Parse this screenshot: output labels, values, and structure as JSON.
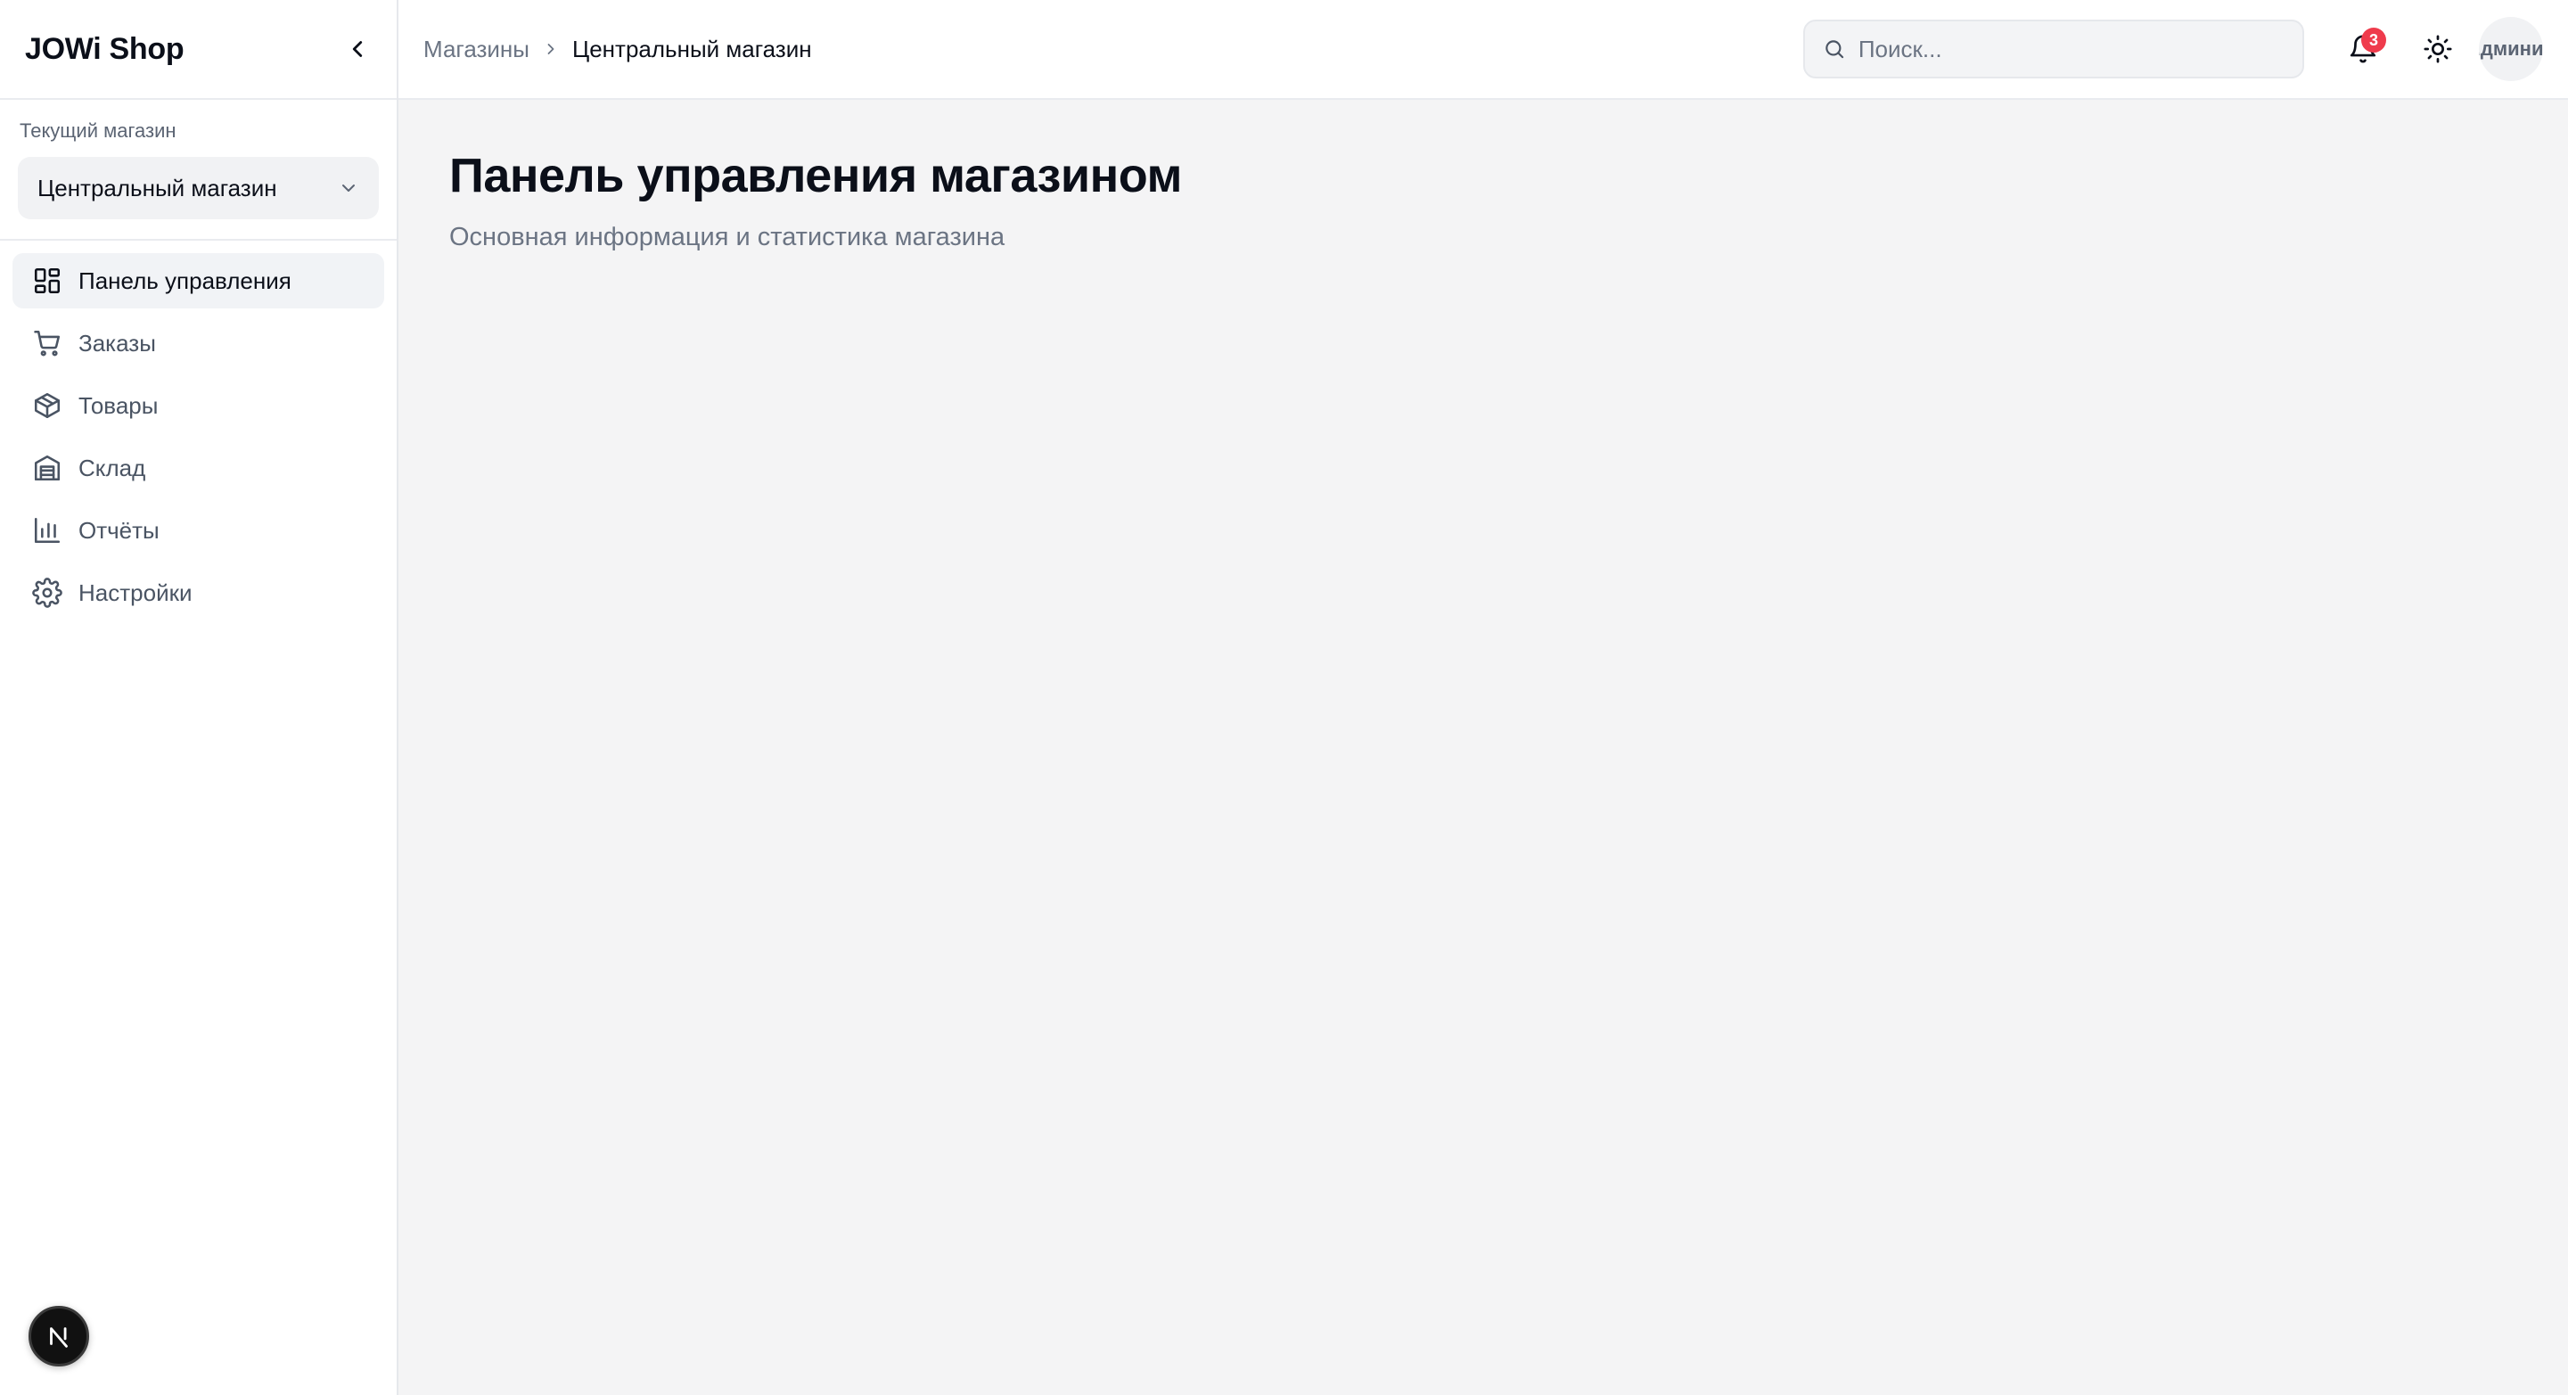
{
  "sidebar": {
    "brand": "JOWi Shop",
    "store_label": "Текущий магазин",
    "store_selected": "Центральный магазин",
    "items": [
      {
        "label": "Панель управления",
        "icon": "dashboard-icon",
        "active": true
      },
      {
        "label": "Заказы",
        "icon": "cart-icon",
        "active": false
      },
      {
        "label": "Товары",
        "icon": "package-icon",
        "active": false
      },
      {
        "label": "Склад",
        "icon": "warehouse-icon",
        "active": false
      },
      {
        "label": "Отчёты",
        "icon": "bar-chart-icon",
        "active": false
      },
      {
        "label": "Настройки",
        "icon": "gear-icon",
        "active": false
      }
    ]
  },
  "header": {
    "breadcrumb": {
      "parent": "Магазины",
      "current": "Центральный магазин"
    },
    "search_placeholder": "Поиск...",
    "notifications_count": "3",
    "avatar_text": "Администратор"
  },
  "main": {
    "title": "Панель управления магазином",
    "subtitle": "Основная информация и статистика магазина"
  },
  "colors": {
    "accent_badge": "#ef3b4c",
    "sidebar_active_bg": "#f1f3f6",
    "page_bg": "#f4f4f5"
  }
}
